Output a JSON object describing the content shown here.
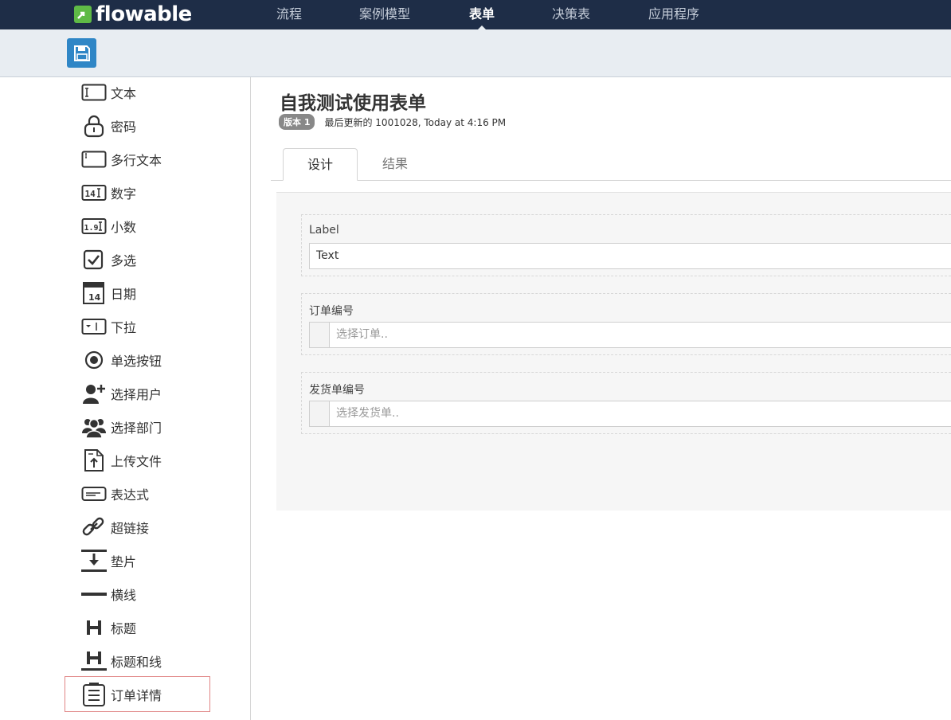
{
  "app": {
    "logo_text": "flowable",
    "brand_color": "#1e2d47",
    "logo_mark_color": "#5fba46"
  },
  "nav": {
    "items": [
      {
        "label": "流程",
        "active": false
      },
      {
        "label": "案例模型",
        "active": false
      },
      {
        "label": "表单",
        "active": true
      },
      {
        "label": "决策表",
        "active": false
      },
      {
        "label": "应用程序",
        "active": false
      }
    ]
  },
  "toolbar": {
    "save_icon": "floppy-disk-icon",
    "save_color": "#2f86c6"
  },
  "palette": {
    "items": [
      {
        "label": "文本",
        "icon": "text-field-icon"
      },
      {
        "label": "密码",
        "icon": "lock-icon"
      },
      {
        "label": "多行文本",
        "icon": "multiline-text-icon"
      },
      {
        "label": "数字",
        "icon": "integer-icon"
      },
      {
        "label": "小数",
        "icon": "decimal-icon"
      },
      {
        "label": "多选",
        "icon": "checkbox-icon"
      },
      {
        "label": "日期",
        "icon": "calendar-icon"
      },
      {
        "label": "下拉",
        "icon": "dropdown-icon"
      },
      {
        "label": "单选按钮",
        "icon": "radio-icon"
      },
      {
        "label": "选择用户",
        "icon": "user-add-icon"
      },
      {
        "label": "选择部门",
        "icon": "group-icon"
      },
      {
        "label": "上传文件",
        "icon": "upload-file-icon"
      },
      {
        "label": "表达式",
        "icon": "expression-icon"
      },
      {
        "label": "超链接",
        "icon": "link-icon"
      },
      {
        "label": "垫片",
        "icon": "spacer-icon"
      },
      {
        "label": "横线",
        "icon": "horizontal-line-icon"
      },
      {
        "label": "标题",
        "icon": "heading-icon"
      },
      {
        "label": "标题和线",
        "icon": "heading-line-icon"
      },
      {
        "label": "订单详情",
        "icon": "clipboard-list-icon"
      }
    ],
    "highlight_color": "#e08585"
  },
  "form": {
    "title": "自我测试使用表单",
    "version_badge": "版本 1",
    "meta_text": "最后更新的 1001028, Today at 4:16 PM"
  },
  "tabs": [
    {
      "label": "设计",
      "active": true
    },
    {
      "label": "结果",
      "active": false
    }
  ],
  "fields": [
    {
      "label": "Label",
      "value": "Text",
      "type": "text"
    },
    {
      "label": "订单编号",
      "placeholder": "选择订单..",
      "type": "select"
    },
    {
      "label": "发货单编号",
      "placeholder": "选择发货单..",
      "type": "select"
    }
  ]
}
